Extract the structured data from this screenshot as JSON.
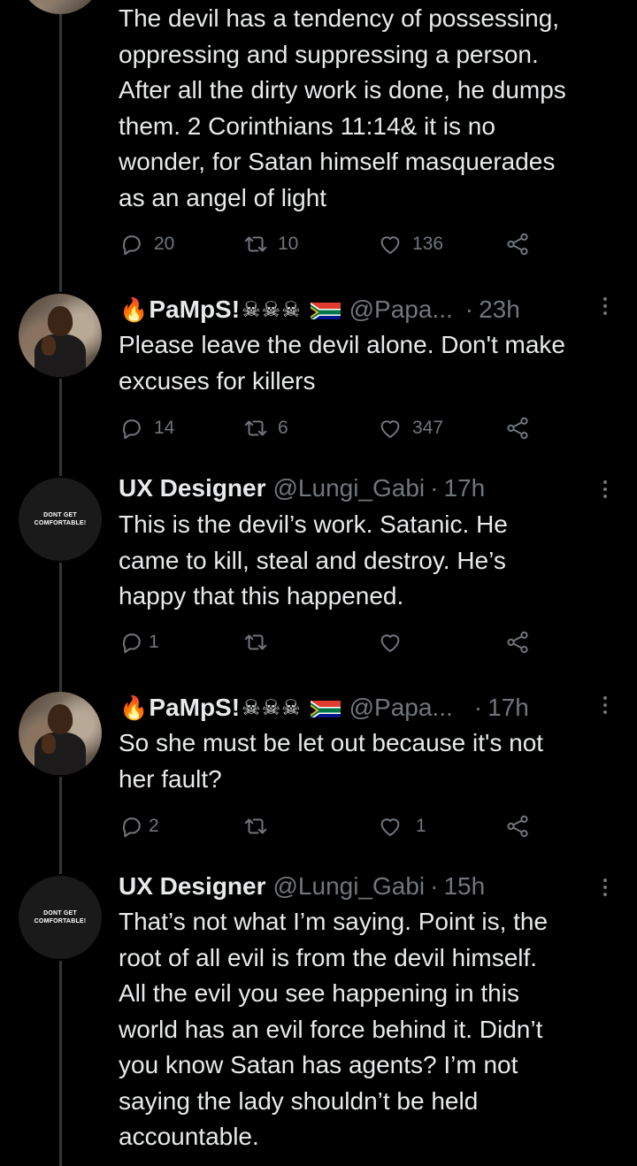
{
  "tweets": [
    {
      "text": "The devil has a tendency of possessing,\noppressing and suppressing a person.\nAfter all the dirty work is done, he dumps\nthem. 2 Corinthians 11:14& it is no\nwonder, for Satan himself masquerades\nas an angel of light",
      "replies": "20",
      "retweets": "10",
      "likes": "136"
    },
    {
      "name": "PaMpS!",
      "name_emoji": "🔥",
      "skulls": "☠☠☠",
      "handle": "@Papa...",
      "dot": "·",
      "time": "23h",
      "text": "Please leave the devil alone. Don't make\nexcuses for killers",
      "replies": "14",
      "retweets": "6",
      "likes": "347"
    },
    {
      "name": "UX Designer",
      "handle": "@Lungi_Gabi",
      "dot": "·",
      "time": "17h",
      "avatar_text": "DONT GET\nCOMFORTABLE!",
      "text": "This is the devil’s work. Satanic. He\ncame to kill, steal and destroy. He’s\nhappy that this happened.",
      "replies": "1",
      "retweets": "",
      "likes": ""
    },
    {
      "name": "PaMpS!",
      "name_emoji": "🔥",
      "skulls": "☠☠☠",
      "handle": "@Papa...",
      "dot": "·",
      "time": "17h",
      "text": "So she must be let out because it's not\nher fault?",
      "replies": "2",
      "retweets": "",
      "likes": "1"
    },
    {
      "name": "UX Designer",
      "handle": "@Lungi_Gabi",
      "dot": "·",
      "time": "15h",
      "avatar_text": "DONT GET\nCOMFORTABLE!",
      "text": "That’s not what I’m saying. Point is, the\nroot of all evil is from the devil himself.\nAll the evil you see happening in this\nworld has an evil force behind it. Didn’t\nyou know Satan has agents? I’m not\nsaying the lady shouldn’t be held\naccountable."
    }
  ],
  "icons": {
    "reply": "reply-icon",
    "retweet": "retweet-icon",
    "like": "heart-icon",
    "share": "share-icon",
    "more": "more-icon",
    "flag": "south-africa-flag-icon"
  },
  "colors": {
    "background": "#000000",
    "text": "#e7e9ea",
    "muted": "#71767b",
    "thread_line": "#333639"
  }
}
